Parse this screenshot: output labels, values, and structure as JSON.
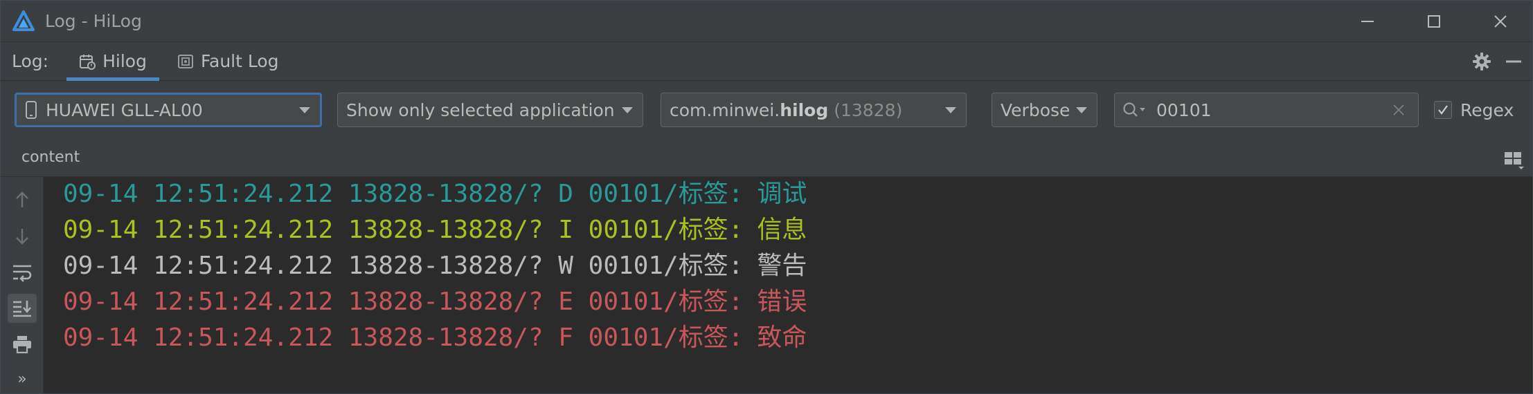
{
  "window": {
    "title": "Log - HiLog"
  },
  "tabbar": {
    "log_label": "Log:",
    "tabs": [
      {
        "label": "Hilog",
        "active": true
      },
      {
        "label": "Fault Log",
        "active": false
      }
    ]
  },
  "toolbar": {
    "device": "HUAWEI GLL-AL00",
    "filter_mode": "Show only selected application",
    "process": {
      "prefix": "com.minwei.",
      "name": "hilog",
      "pid": "(13828)"
    },
    "level": "Verbose",
    "search_value": "00101",
    "regex_label": "Regex",
    "regex_checked": true
  },
  "content_header": {
    "label": "content"
  },
  "logs": [
    {
      "date": "09-14",
      "time": "12:51:24.212",
      "pids": "13828-13828/?",
      "level": "D",
      "tag": "00101/标签:",
      "message": "调试"
    },
    {
      "date": "09-14",
      "time": "12:51:24.212",
      "pids": "13828-13828/?",
      "level": "I",
      "tag": "00101/标签:",
      "message": "信息"
    },
    {
      "date": "09-14",
      "time": "12:51:24.212",
      "pids": "13828-13828/?",
      "level": "W",
      "tag": "00101/标签:",
      "message": "警告"
    },
    {
      "date": "09-14",
      "time": "12:51:24.212",
      "pids": "13828-13828/?",
      "level": "E",
      "tag": "00101/标签:",
      "message": "错误"
    },
    {
      "date": "09-14",
      "time": "12:51:24.212",
      "pids": "13828-13828/?",
      "level": "F",
      "tag": "00101/标签:",
      "message": "致命"
    }
  ],
  "colors": {
    "debug": "#299999",
    "info": "#abc023",
    "warn": "#bbbbbb",
    "error": "#c7575b",
    "fatal": "#c7575b",
    "accent": "#4a88c7"
  },
  "icons": {
    "title": "harmony-logo-icon",
    "side": [
      "arrow-up-icon",
      "arrow-down-icon",
      "soft-wrap-icon",
      "scroll-to-end-icon",
      "print-icon",
      "more-icon"
    ]
  }
}
